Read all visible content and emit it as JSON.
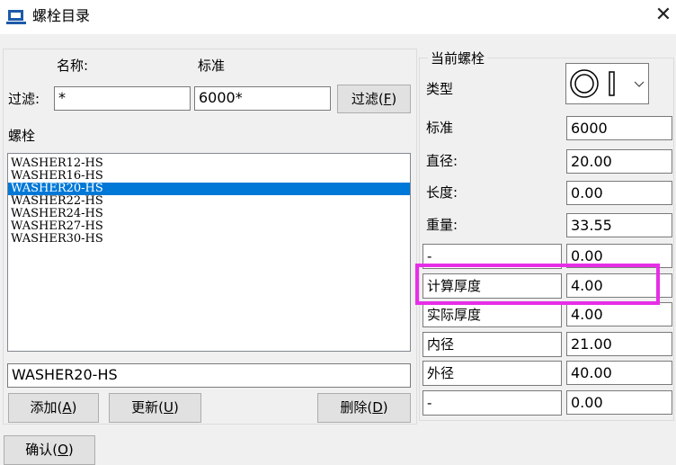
{
  "window": {
    "title": "螺栓目录",
    "close_glyph": "✕"
  },
  "filter": {
    "name_header": "名称:",
    "standard_header": "标准",
    "label": "过滤:",
    "name_value": "*",
    "standard_value": "6000*",
    "button_label": "过滤",
    "button_hotkey": "F"
  },
  "bolt_list": {
    "label": "螺栓",
    "items": [
      "WASHER12-HS",
      "WASHER16-HS",
      "WASHER20-HS",
      "WASHER22-HS",
      "WASHER24-HS",
      "WASHER27-HS",
      "WASHER30-HS"
    ],
    "selected_index": 2,
    "name_value": "WASHER20-HS"
  },
  "buttons": {
    "add": {
      "label": "添加",
      "hotkey": "A"
    },
    "update": {
      "label": "更新",
      "hotkey": "U"
    },
    "delete": {
      "label": "删除",
      "hotkey": "D"
    },
    "confirm": {
      "label": "确认",
      "hotkey": "O"
    }
  },
  "current_bolt": {
    "group_title": "当前螺栓",
    "type_label": "类型",
    "fields": [
      {
        "label": "标准",
        "value": "6000"
      },
      {
        "label": "直径:",
        "value": "20.00"
      },
      {
        "label": "长度:",
        "value": "0.00"
      },
      {
        "label": "重量:",
        "value": "33.55"
      }
    ],
    "editable_fields": [
      {
        "label": "-",
        "value": "0.00"
      },
      {
        "label": "计算厚度",
        "value": "4.00"
      },
      {
        "label": "实际厚度",
        "value": "4.00"
      },
      {
        "label": "内径",
        "value": "21.00"
      },
      {
        "label": "外径",
        "value": "40.00"
      },
      {
        "label": "-",
        "value": "0.00"
      }
    ]
  },
  "colors": {
    "selection": "#0078d7",
    "highlight": "#e72ee7",
    "icon_blue": "#1e5aa8"
  }
}
